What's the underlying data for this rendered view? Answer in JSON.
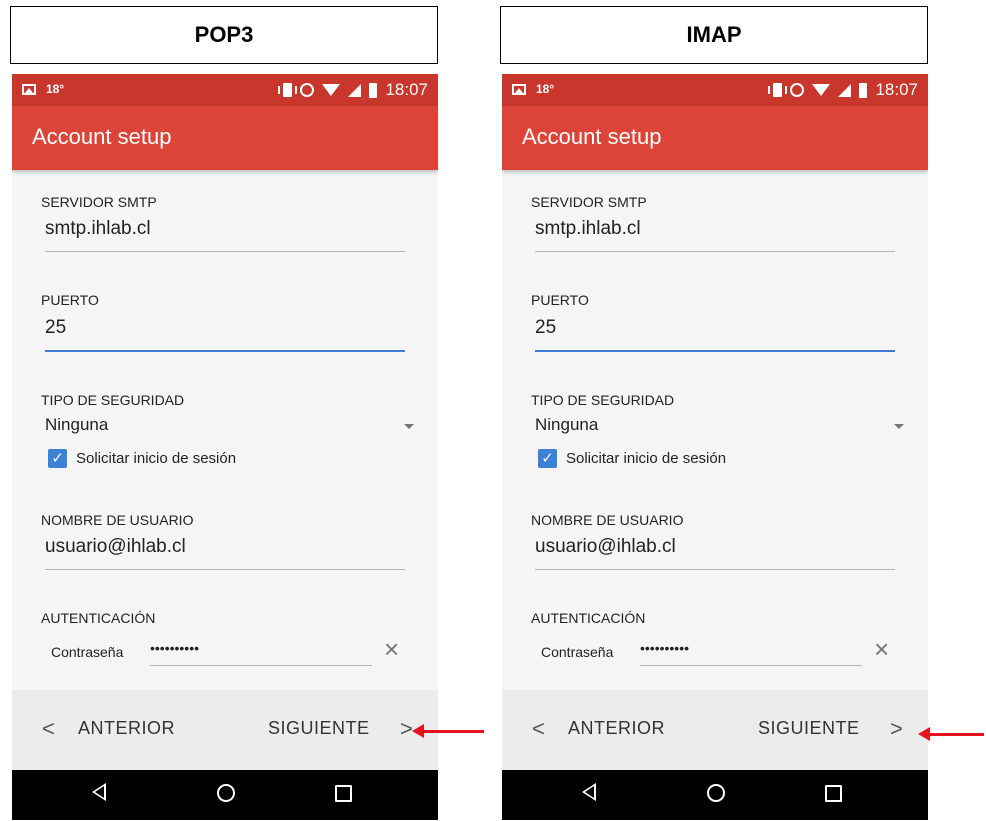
{
  "panels": [
    {
      "label": "POP3",
      "status": {
        "temp": "18°",
        "time": "18:07"
      },
      "appbar_title": "Account setup",
      "fields": {
        "smtp_label": "SERVIDOR SMTP",
        "smtp_value": "smtp.ihlab.cl",
        "port_label": "PUERTO",
        "port_value": "25",
        "security_label": "TIPO DE SEGURIDAD",
        "security_value": "Ninguna",
        "require_signin_label": "Solicitar inicio de sesión",
        "username_label": "NOMBRE DE USUARIO",
        "username_value": "usuario@ihlab.cl",
        "auth_label": "AUTENTICACIÓN",
        "password_label": "Contraseña",
        "password_value": "••••••••••"
      },
      "nav": {
        "prev": "ANTERIOR",
        "next": "SIGUIENTE",
        "prev_chevron": "<",
        "next_chevron": ">"
      }
    },
    {
      "label": "IMAP",
      "status": {
        "temp": "18°",
        "time": "18:07"
      },
      "appbar_title": "Account setup",
      "fields": {
        "smtp_label": "SERVIDOR SMTP",
        "smtp_value": "smtp.ihlab.cl",
        "port_label": "PUERTO",
        "port_value": "25",
        "security_label": "TIPO DE SEGURIDAD",
        "security_value": "Ninguna",
        "require_signin_label": "Solicitar inicio de sesión",
        "username_label": "NOMBRE DE USUARIO",
        "username_value": "usuario@ihlab.cl",
        "auth_label": "AUTENTICACIÓN",
        "password_label": "Contraseña",
        "password_value": "••••••••••"
      },
      "nav": {
        "prev": "ANTERIOR",
        "next": "SIGUIENTE",
        "prev_chevron": "<",
        "next_chevron": ">"
      }
    }
  ],
  "icons": {
    "clear": "×",
    "check": "✓",
    "status_bar": [
      "image-icon",
      "vibrate-icon",
      "alarm-icon",
      "wifi-icon",
      "signal-icon",
      "battery-icon"
    ],
    "system_nav": [
      "back-icon",
      "home-icon",
      "recents-icon"
    ],
    "indicator": "red-arrow-pointing-to-next"
  },
  "colors": {
    "status_bar": "#c8362c",
    "app_bar": "#db4437",
    "accent": "#3b82d7",
    "annotation_arrow": "#e8121e"
  }
}
